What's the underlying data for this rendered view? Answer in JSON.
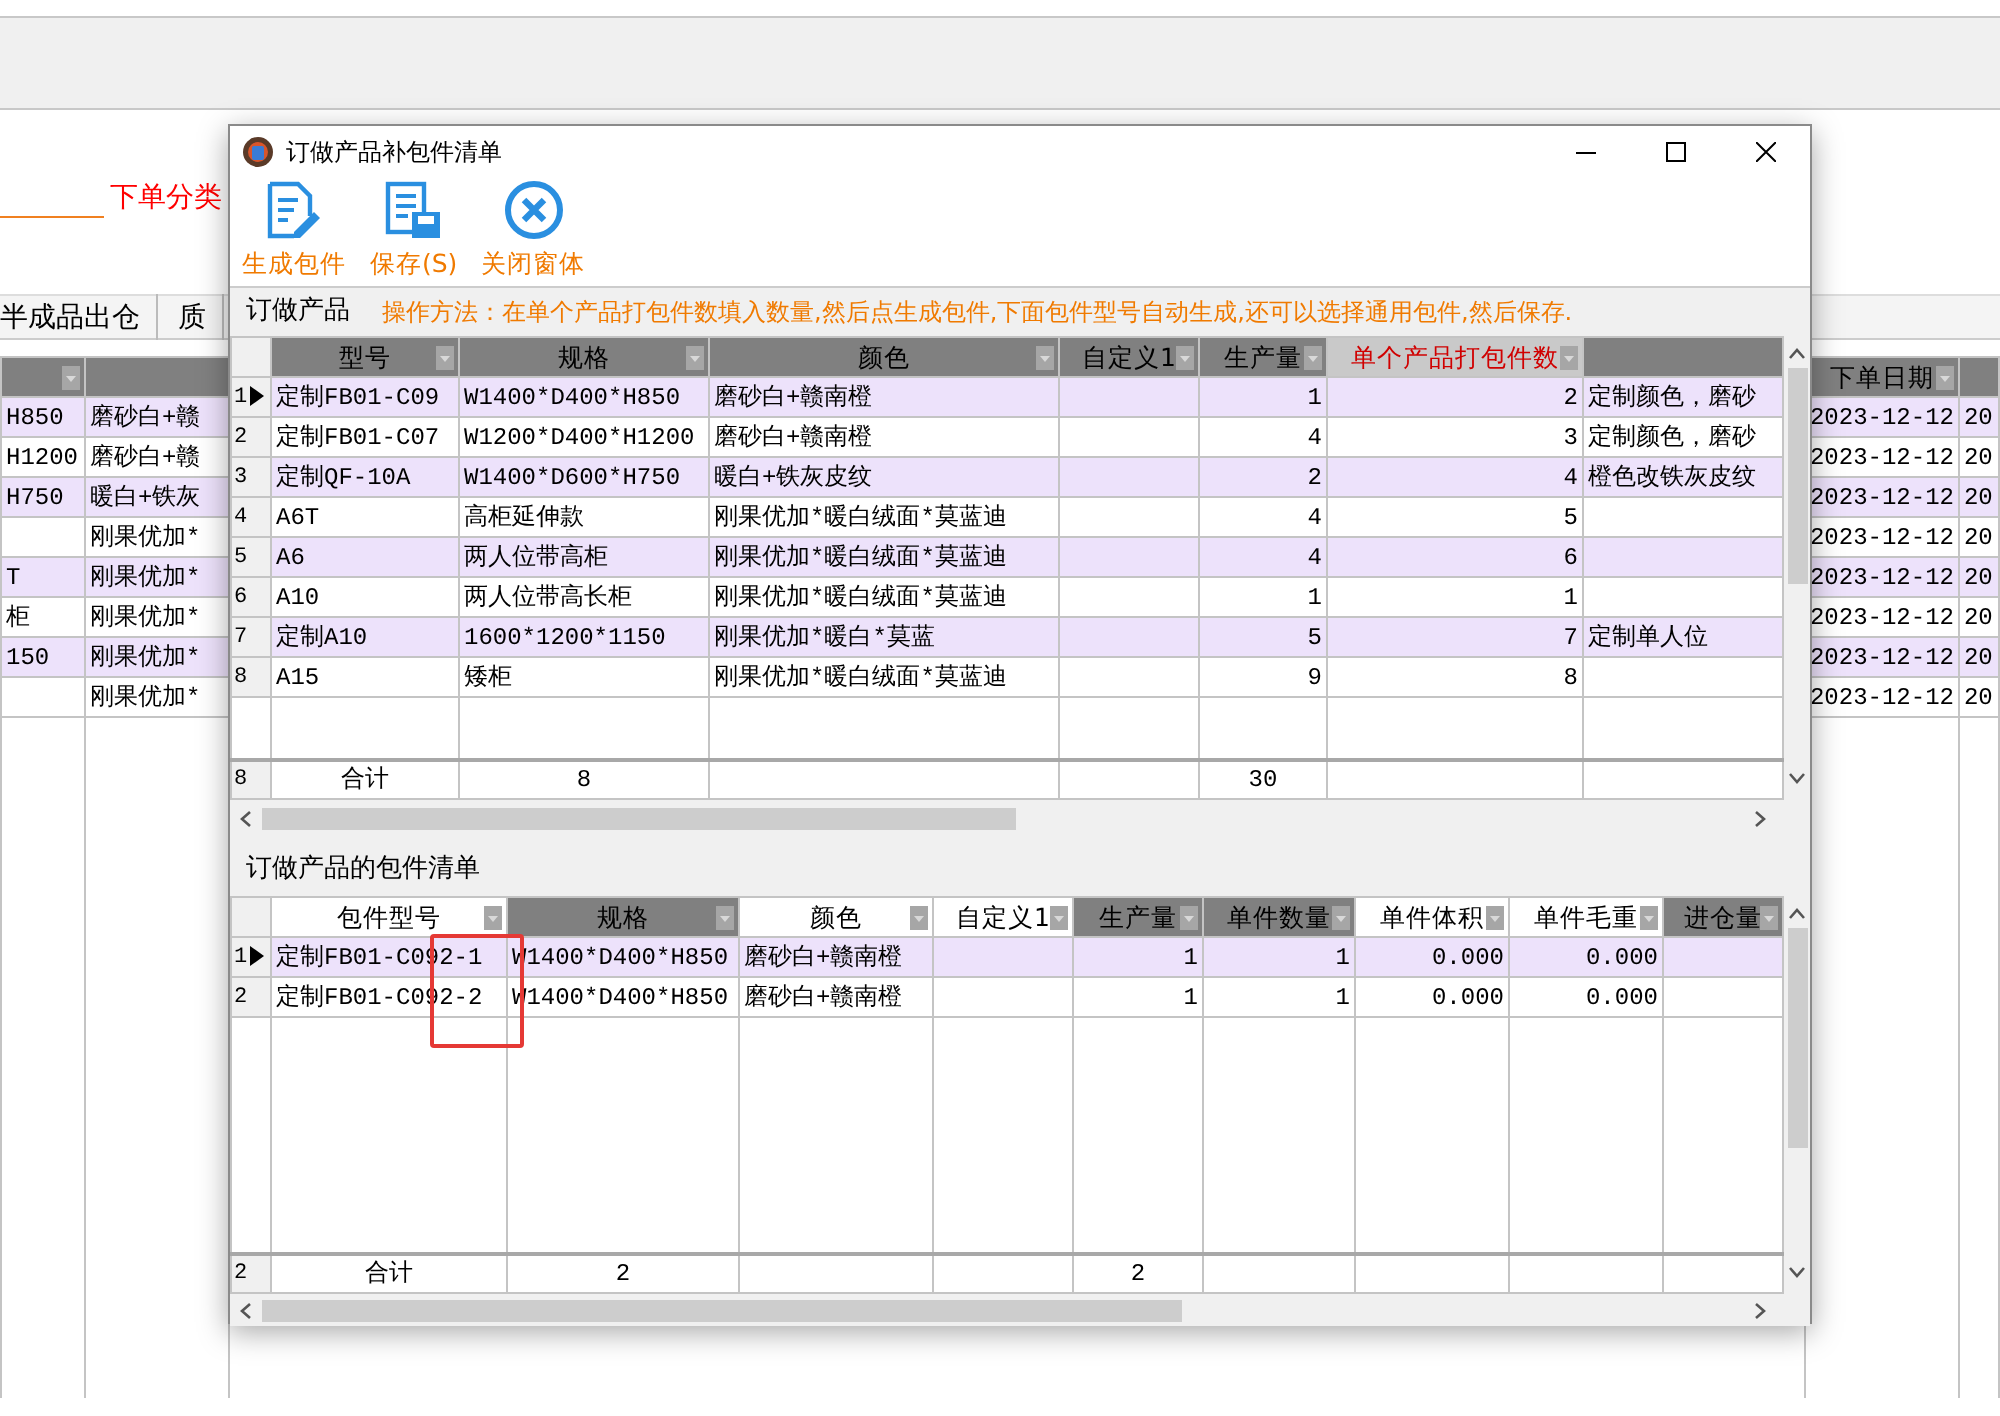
{
  "background": {
    "filter": {
      "label": "下单分类"
    },
    "tabs": [
      {
        "label": "半成品出仓"
      },
      {
        "label": "质"
      }
    ],
    "grid": {
      "date_header": "下单日期",
      "rows": [
        {
          "column_1": "H850",
          "column_2": "磨砂白+赣",
          "date": "2023-12-12",
          "column_5": "20"
        },
        {
          "column_1": "H1200",
          "column_2": "磨砂白+赣",
          "date": "2023-12-12",
          "column_5": "20"
        },
        {
          "column_1": "H750",
          "column_2": "暖白+铁灰",
          "date": "2023-12-12",
          "column_5": "20"
        },
        {
          "column_2": "刚果优加*",
          "date": "2023-12-12",
          "column_5": "20"
        },
        {
          "column_1": "T",
          "column_2": "刚果优加*",
          "date": "2023-12-12",
          "column_5": "20"
        },
        {
          "column_1": "柜",
          "column_2": "刚果优加*",
          "date": "2023-12-12",
          "column_5": "20"
        },
        {
          "column_1": "150",
          "column_2": "刚果优加*",
          "date": "2023-12-12",
          "column_5": "20"
        },
        {
          "column_2": "刚果优加*",
          "date": "2023-12-12",
          "column_5": "20"
        }
      ]
    }
  },
  "window": {
    "title": "订做产品补包件清单"
  },
  "toolbar": [
    {
      "kind": "generate",
      "label": "生成包件"
    },
    {
      "kind": "save",
      "label": "保存(S)"
    },
    {
      "kind": "close",
      "label": "关闭窗体"
    }
  ],
  "products": {
    "title": "订做产品",
    "hint": "操作方法：在单个产品打包件数填入数量,然后点生成包件,下面包件型号自动生成,还可以选择通用包件,然后保存.",
    "columns": [
      {
        "label": "型号",
        "shaded": true,
        "emphasized": false
      },
      {
        "label": "规格",
        "shaded": true,
        "emphasized": false
      },
      {
        "label": "颜色",
        "shaded": true,
        "emphasized": false
      },
      {
        "label": "自定义1",
        "shaded": true,
        "emphasized": false
      },
      {
        "label": "生产量",
        "shaded": true,
        "emphasized": false
      },
      {
        "label": "单个产品打包件数",
        "shaded": true,
        "emphasized": true
      },
      {
        "shaded": true,
        "emphasized": false
      }
    ],
    "rows": [
      {
        "number": "1",
        "selected": true,
        "model": "定制FB01-C09",
        "spec": "W1400*D400*H850",
        "finish": "磨砂白+赣南橙",
        "quantity": "1",
        "packages": "2",
        "remark": "定制颜色，磨砂"
      },
      {
        "number": "2",
        "selected": false,
        "model": "定制FB01-C07",
        "spec": "W1200*D400*H1200",
        "finish": "磨砂白+赣南橙",
        "quantity": "4",
        "packages": "3",
        "remark": "定制颜色，磨砂"
      },
      {
        "number": "3",
        "selected": false,
        "model": "定制QF-10A",
        "spec": "W1400*D600*H750",
        "finish": "暖白+铁灰皮纹",
        "quantity": "2",
        "packages": "4",
        "remark": "橙色改铁灰皮纹"
      },
      {
        "number": "4",
        "selected": false,
        "model": "A6T",
        "spec": "高柜延伸款",
        "finish": "刚果优加*暖白绒面*莫蓝迪",
        "quantity": "4",
        "packages": "5"
      },
      {
        "number": "5",
        "selected": false,
        "model": "A6",
        "spec": "两人位带高柜",
        "finish": "刚果优加*暖白绒面*莫蓝迪",
        "quantity": "4",
        "packages": "6"
      },
      {
        "number": "6",
        "selected": false,
        "model": "A10",
        "spec": "两人位带高长柜",
        "finish": "刚果优加*暖白绒面*莫蓝迪",
        "quantity": "1",
        "packages": "1"
      },
      {
        "number": "7",
        "selected": false,
        "model": "定制A10",
        "spec": "1600*1200*1150",
        "finish": "刚果优加*暖白*莫蓝",
        "quantity": "5",
        "packages": "7",
        "remark": "定制单人位"
      },
      {
        "number": "8",
        "selected": false,
        "model": "A15",
        "spec": "矮柜",
        "finish": "刚果优加*暖白绒面*莫蓝迪",
        "quantity": "9",
        "packages": "8"
      }
    ],
    "total": {
      "count": "8",
      "label": "合计",
      "spec": "8",
      "quantity": "30"
    }
  },
  "packages": {
    "title": "订做产品的包件清单",
    "columns": [
      {
        "label": "包件型号",
        "shaded": false
      },
      {
        "label": "规格",
        "shaded": true
      },
      {
        "label": "颜色",
        "shaded": false
      },
      {
        "label": "自定义1",
        "shaded": false
      },
      {
        "label": "生产量",
        "shaded": true
      },
      {
        "label": "单件数量",
        "shaded": true
      },
      {
        "label": "单件体积",
        "shaded": false
      },
      {
        "label": "单件毛重",
        "shaded": false
      },
      {
        "label": "进仓量",
        "shaded": true
      }
    ],
    "rows": [
      {
        "number": "1",
        "selected": true,
        "model": "定制FB01-C092-1",
        "spec": "W1400*D400*H850",
        "finish": "磨砂白+赣南橙",
        "quantity": "1",
        "pieces": "1",
        "volume": "0.000",
        "weight": "0.000"
      },
      {
        "number": "2",
        "selected": false,
        "model": "定制FB01-C092-2",
        "spec": "W1400*D400*H850",
        "finish": "磨砂白+赣南橙",
        "quantity": "1",
        "pieces": "1",
        "volume": "0.000",
        "weight": "0.000"
      }
    ],
    "total": {
      "count": "2",
      "label": "合计",
      "spec": "2",
      "quantity": "2"
    }
  },
  "annotation": {
    "kind": "rectangle"
  }
}
